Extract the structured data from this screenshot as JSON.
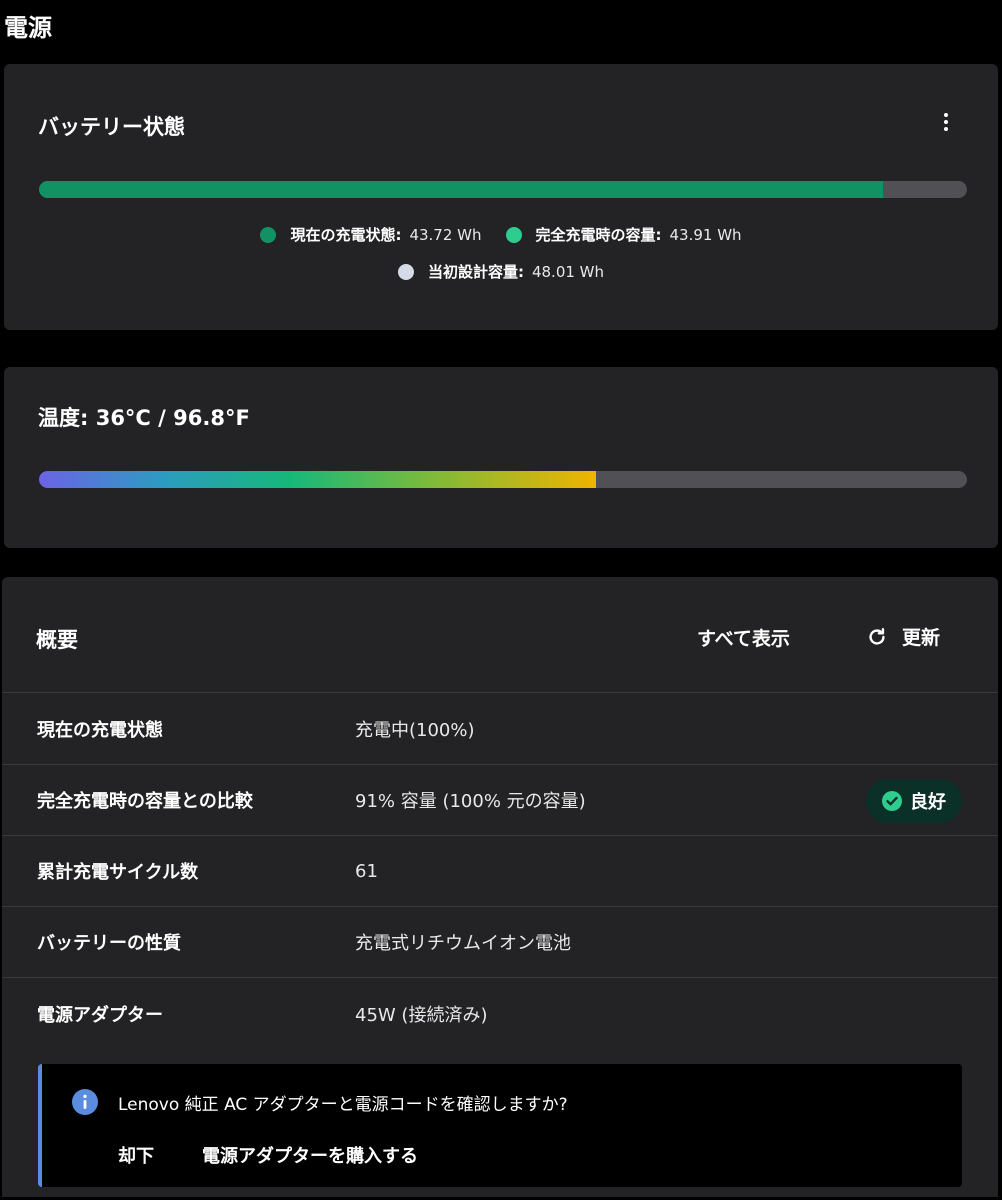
{
  "page": {
    "title": "電源"
  },
  "battery": {
    "title": "バッテリー状態",
    "charge_fraction": 0.91,
    "legend": [
      {
        "label": "現在の充電状態:",
        "value": "43.72 Wh",
        "color": "#119265"
      },
      {
        "label": "完全充電時の容量:",
        "value": "43.91 Wh",
        "color": "#2ecc8f"
      },
      {
        "label": "当初設計容量:",
        "value": "48.01 Wh",
        "color": "#d6dbe8"
      }
    ],
    "more_icon": "more-vertical-icon"
  },
  "temperature": {
    "title": "温度:  36°C / 96.8°F",
    "level_fraction": 0.6
  },
  "overview": {
    "title": "概要",
    "show_all_label": "すべて表示",
    "refresh_label": "更新",
    "refresh_icon": "refresh-icon",
    "rows": [
      {
        "label": "現在の充電状態",
        "value": "充電中(100%)"
      },
      {
        "label": "完全充電時の容量との比較",
        "value": "91% 容量 (100% 元の容量)",
        "badge": "良好"
      },
      {
        "label": "累計充電サイクル数",
        "value": "61"
      },
      {
        "label": "バッテリーの性質",
        "value": "充電式リチウムイオン電池"
      },
      {
        "label": "電源アダプター",
        "value": "45W (接続済み)"
      }
    ],
    "badge_color": "#2ecc8f"
  },
  "notice": {
    "icon": "info-icon",
    "text": "Lenovo 純正 AC アダプターと電源コードを確認しますか?",
    "dismiss_label": "却下",
    "buy_label": "電源アダプターを購入する",
    "accent_color": "#5a8de0"
  }
}
